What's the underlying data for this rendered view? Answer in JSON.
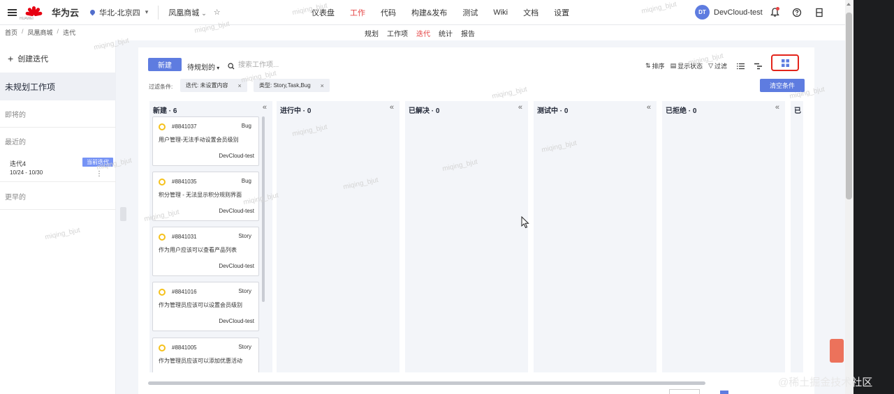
{
  "topbar": {
    "brand": "华为云",
    "logo_sub": "HUAWEI",
    "region": "华北-北京四",
    "project": "凤凰商城",
    "nav": [
      "仪表盘",
      "工作",
      "代码",
      "构建&发布",
      "测试",
      "Wiki",
      "文档",
      "设置"
    ],
    "active_nav": "工作",
    "avatar_initials": "DT",
    "username": "DevCloud-test"
  },
  "breadcrumb": [
    "首页",
    "凤凰商城",
    "迭代"
  ],
  "subnav": [
    "规划",
    "工作项",
    "迭代",
    "统计",
    "报告"
  ],
  "active_subnav": "迭代",
  "sidebar": {
    "create_label": "创建迭代",
    "unplanned": "未规划工作项",
    "section_upcoming": "即将的",
    "section_recent": "最近的",
    "iteration": {
      "name": "迭代4",
      "dates": "10/24 - 10/30",
      "badge": "当前迭代"
    },
    "section_past": "更早的"
  },
  "toolbar": {
    "new_label": "新建",
    "view_label": "待规划的",
    "search_placeholder": "搜索工作项...",
    "sort_label": "排序",
    "display_label": "显示状态",
    "filter_label": "过滤"
  },
  "filters": {
    "label": "过滤条件:",
    "chips": [
      "迭代: 未设置内容",
      "类型: Story,Task,Bug"
    ],
    "clear_label": "清空条件"
  },
  "board": {
    "columns": [
      {
        "name": "新建 · 6"
      },
      {
        "name": "进行中 · 0"
      },
      {
        "name": "已解决 · 0"
      },
      {
        "name": "测试中 · 0"
      },
      {
        "name": "已拒绝 · 0"
      },
      {
        "name": "已"
      }
    ],
    "cards": [
      {
        "id": "#8841037",
        "type": "Bug",
        "title": "用户管理-无法手动设置会员级别",
        "owner": "DevCloud-test"
      },
      {
        "id": "#8841035",
        "type": "Bug",
        "title": "积分管理 - 无法显示积分规则界面",
        "owner": "DevCloud-test"
      },
      {
        "id": "#8841031",
        "type": "Story",
        "title": "作为用户应该可以查看产品列表",
        "owner": "DevCloud-test"
      },
      {
        "id": "#8841016",
        "type": "Story",
        "title": "作为管理员应该可以设置会员级别",
        "owner": "DevCloud-test"
      },
      {
        "id": "#8841005",
        "type": "Story",
        "title": "作为管理员应该可以添加优惠活动",
        "owner": ""
      }
    ]
  },
  "watermark": "miqing_bjut",
  "community": "@稀土掘金技术社区",
  "colors": {
    "accent": "#5e7ce0",
    "active_nav": "#e54545",
    "highlight_box": "#e3241b",
    "status_circle": "#f5c11b"
  }
}
